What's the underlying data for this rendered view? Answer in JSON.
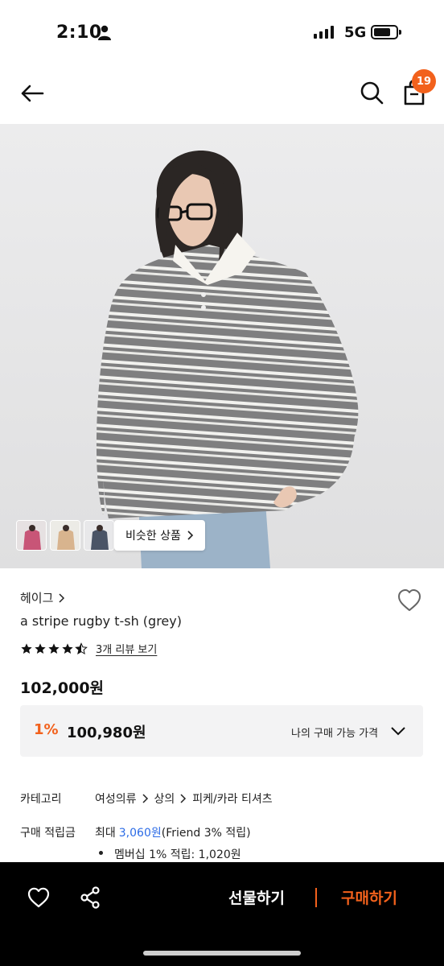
{
  "status_bar": {
    "time": "2:10",
    "network": "5G"
  },
  "nav": {
    "cart_count": "19"
  },
  "gallery": {
    "similar_label": "비슷한 상품"
  },
  "product": {
    "brand": "헤이그",
    "name": "a stripe rugby t-sh (grey)",
    "rating": 4.5,
    "review_link": "3개 리뷰 보기",
    "price": "102,000원"
  },
  "member_price": {
    "discount": "1%",
    "price": "100,980원",
    "label": "나의 구매 가능 가격"
  },
  "info": {
    "category_label": "카테고리",
    "categories": [
      "여성의류",
      "상의",
      "피케/카라 티셔츠"
    ],
    "points_label": "구매 적립금",
    "points_prefix": "최대",
    "points_amount": "3,060원",
    "points_suffix": "(Friend 3% 적립)",
    "membership_points": "멤버십 1% 적립: 1,020원"
  },
  "bottom_bar": {
    "gift_label": "선물하기",
    "buy_label": "구매하기"
  },
  "colors": {
    "accent": "#f2611c",
    "link_blue": "#2b6be6",
    "bottom_bar_bg": "#000000"
  }
}
